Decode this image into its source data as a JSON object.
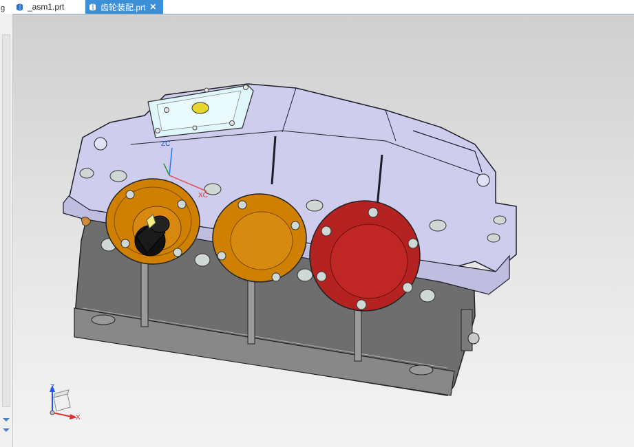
{
  "tabs": [
    {
      "label": "_asm1.prt",
      "active": false
    },
    {
      "label": "齿轮装配.prt",
      "active": true
    }
  ],
  "close_glyph": "✕",
  "left_panel": {
    "top_char": "g"
  },
  "triad": {
    "z": "Z",
    "x": "X"
  },
  "model_csys": {
    "zc": "ZC",
    "xc": "XC"
  },
  "colors": {
    "housing": "#cfcdee",
    "base": "#6e6e6e",
    "cover_orange": "#d08000",
    "cover_red": "#b52222",
    "tab_active": "#3b8fd6"
  }
}
